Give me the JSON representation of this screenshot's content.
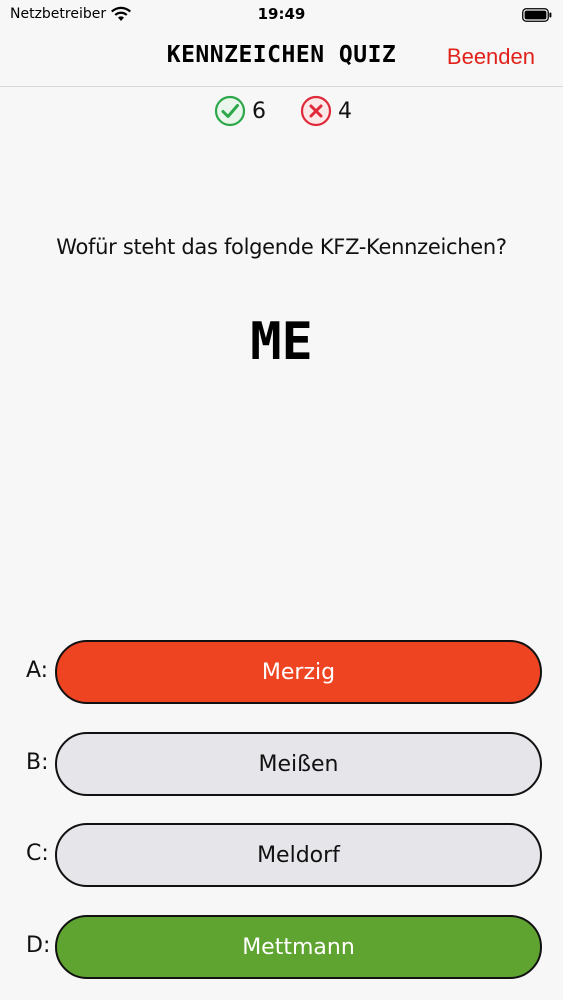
{
  "status_bar": {
    "carrier": "Netzbetreiber",
    "time": "19:49",
    "icons": [
      "wifi-icon",
      "battery-icon"
    ]
  },
  "nav": {
    "title": "KENNZEICHEN QUIZ",
    "action_label": "Beenden",
    "action_color": "#e0221b"
  },
  "score": {
    "correct_count": "6",
    "wrong_count": "4",
    "correct_icon": "check-circle-icon",
    "wrong_icon": "x-circle-icon",
    "correct_color": "#2ca84a",
    "wrong_color": "#e02a3a"
  },
  "question": {
    "text": "Wofür steht das folgende KFZ-Kennzeichen?",
    "plate": "ME"
  },
  "answers": [
    {
      "letter": "A:",
      "label": "Merzig",
      "state": "wrong",
      "color": "#ee4422"
    },
    {
      "letter": "B:",
      "label": "Meißen",
      "state": "neutral",
      "color": "#e5e5ea"
    },
    {
      "letter": "C:",
      "label": "Meldorf",
      "state": "neutral",
      "color": "#e5e5ea"
    },
    {
      "letter": "D:",
      "label": "Mettmann",
      "state": "correct",
      "color": "#5fa431"
    }
  ]
}
